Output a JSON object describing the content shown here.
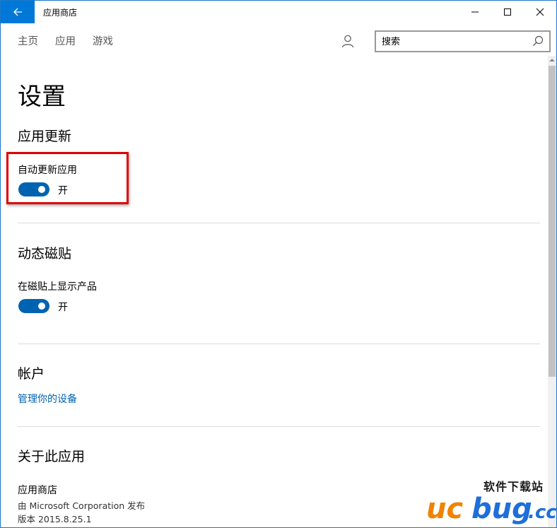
{
  "titlebar": {
    "app_title": "应用商店",
    "back_icon": "back-arrow-icon",
    "minimize_icon": "minimize-icon",
    "maximize_icon": "maximize-icon",
    "close_icon": "close-icon"
  },
  "nav": {
    "items": [
      {
        "label": "主页"
      },
      {
        "label": "应用"
      },
      {
        "label": "游戏"
      }
    ],
    "user_icon": "user-icon",
    "search": {
      "placeholder": "搜索",
      "icon": "search-icon"
    }
  },
  "page": {
    "title": "设置",
    "sections": {
      "app_updates": {
        "heading": "应用更新",
        "setting_label": "自动更新应用",
        "toggle_state": "开",
        "toggle_on": true
      },
      "live_tiles": {
        "heading": "动态磁贴",
        "setting_label": "在磁贴上显示产品",
        "toggle_state": "开",
        "toggle_on": true
      },
      "account": {
        "heading": "帐户",
        "link": "管理你的设备"
      },
      "about": {
        "heading": "关于此应用",
        "app_name": "应用商店",
        "publisher": "由 Microsoft Corporation 发布",
        "version": "版本 2015.8.25.1"
      }
    }
  },
  "watermark": {
    "text": "软件下载站",
    "logo_text": "ucbug.cc"
  },
  "colors": {
    "accent": "#0078d7",
    "toggle_on": "#0063b1",
    "highlight_border": "#e00000",
    "watermark_orange": "#f08300",
    "watermark_blue": "#1e6fd9"
  }
}
